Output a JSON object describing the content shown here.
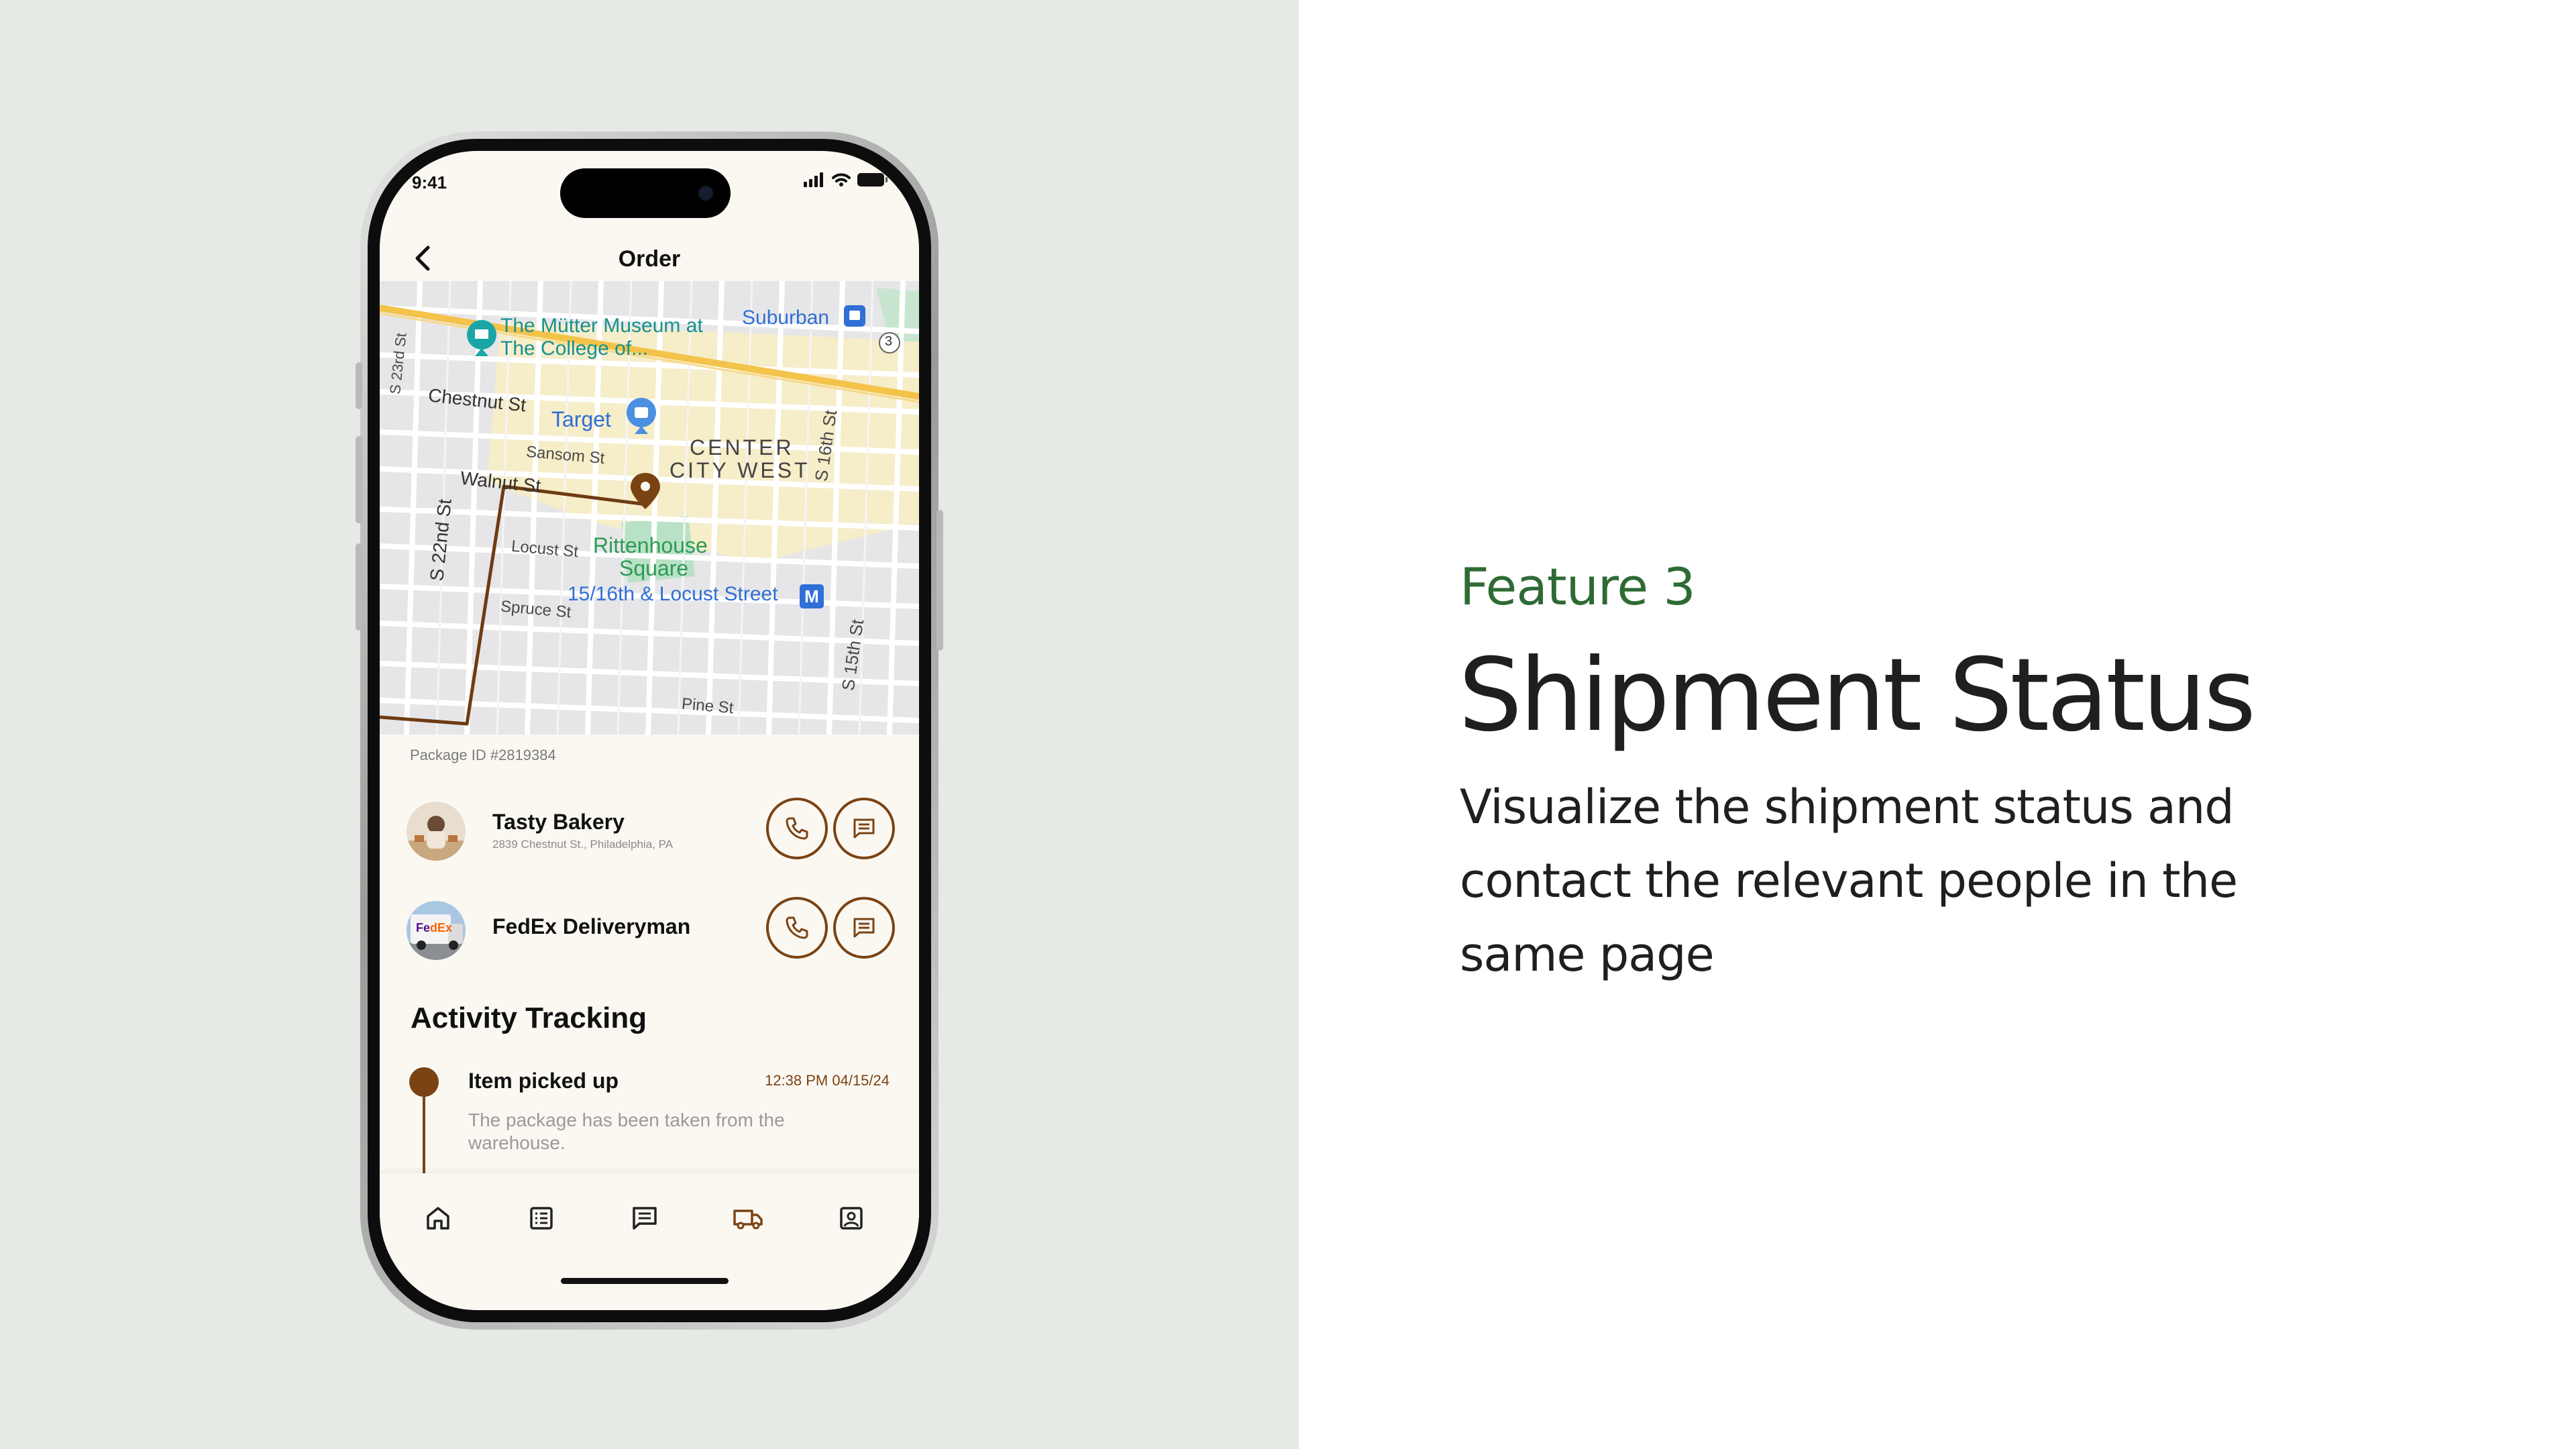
{
  "slide": {
    "feature_label": "Feature 3",
    "title": "Shipment Status",
    "description": "Visualize the shipment status and contact the relevant people in the same page"
  },
  "status_bar": {
    "time": "9:41"
  },
  "header": {
    "title": "Order"
  },
  "map": {
    "labels": {
      "mutter_museum_1": "The Mütter Museum at",
      "mutter_museum_2": "The College of...",
      "suburban": "Suburban",
      "route_badge": "3",
      "chestnut": "Chestnut St",
      "target": "Target",
      "sansom": "Sansom St",
      "center_city_1": "CENTER",
      "center_city_2": "CITY WEST",
      "walnut": "Walnut St",
      "s16th": "S 16th St",
      "s23rd": "S 23rd St",
      "s22nd": "S 22nd St",
      "locust": "Locust St",
      "rittenhouse_1": "Rittenhouse",
      "rittenhouse_2": "Square",
      "locust_station": "15/16th & Locust Street",
      "spruce": "Spruce St",
      "s15th": "S 15th St",
      "pine": "Pine St"
    }
  },
  "package": {
    "id_label": "Package ID #2819384"
  },
  "contacts": [
    {
      "name": "Tasty Bakery",
      "address": "2839 Chestnut St., Philadelphia, PA"
    },
    {
      "name": "FedEx Deliveryman",
      "address": ""
    }
  ],
  "activity": {
    "title": "Activity Tracking",
    "events": [
      {
        "title": "Item picked up",
        "time": "12:38 PM 04/15/24",
        "description": "The package has been taken from the warehouse."
      }
    ]
  },
  "tab_bar": {
    "tabs": [
      {
        "icon": "home-icon",
        "active": false
      },
      {
        "icon": "list-icon",
        "active": false
      },
      {
        "icon": "chat-icon",
        "active": false
      },
      {
        "icon": "truck-icon",
        "active": true
      },
      {
        "icon": "profile-icon",
        "active": false
      }
    ]
  },
  "colors": {
    "accent": "#7b4313",
    "feature_green": "#2e6b34",
    "left_bg": "#e6eae4",
    "screen_bg": "#fbf8f2"
  }
}
